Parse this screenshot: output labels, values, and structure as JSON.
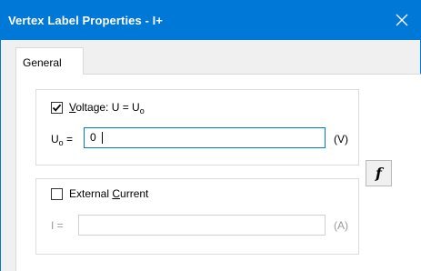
{
  "window": {
    "title": "Vertex Label Properties - I+",
    "close_icon": "close-icon"
  },
  "tabs": [
    {
      "label": "General",
      "selected": true
    }
  ],
  "voltage_group": {
    "checkbox_checked": true,
    "label_mnemonic": "V",
    "label_rest": "oltage: U = U",
    "label_subscript": "o",
    "field_label_main": "U",
    "field_label_subscript": "o",
    "field_label_eq": "=",
    "value": "0",
    "unit": "(V)"
  },
  "function_button": {
    "label": "f"
  },
  "current_group": {
    "checkbox_checked": false,
    "label_prefix": "External ",
    "label_mnemonic": "C",
    "label_rest": "urrent",
    "field_label": "I =",
    "value": "",
    "unit": "(A)",
    "enabled": false
  },
  "colors": {
    "title_bar": "#0078d7",
    "focus_border": "#0078d7",
    "dialog_background": "#f0f0f0",
    "disabled_text": "#9a9a9a"
  }
}
